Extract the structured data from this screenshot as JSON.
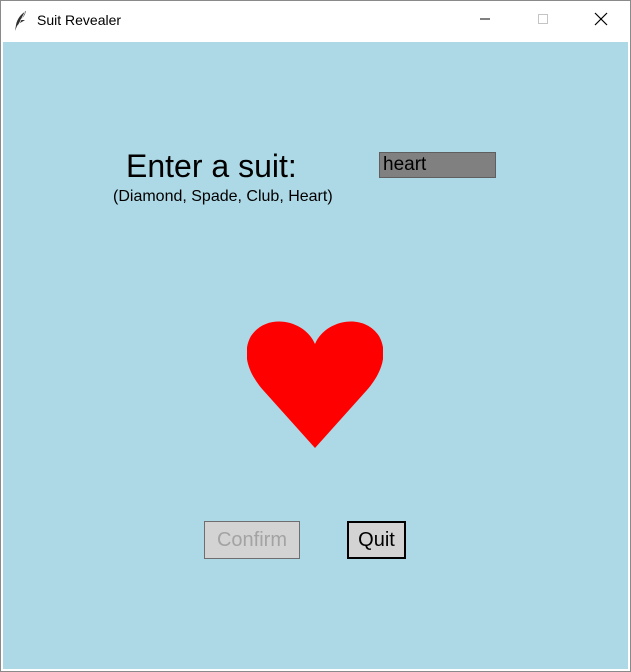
{
  "window": {
    "title": "Suit Revealer",
    "icon": "feather-icon"
  },
  "titlebar_buttons": {
    "minimize": "minimize-icon",
    "maximize": "maximize-icon",
    "close": "close-icon"
  },
  "form": {
    "prompt": "Enter a suit:",
    "hint": "(Diamond, Spade, Club, Heart)",
    "input_value": "heart"
  },
  "display": {
    "suit": "heart",
    "suit_color": "#ff0000"
  },
  "buttons": {
    "confirm_label": "Confirm",
    "confirm_state": "disabled",
    "quit_label": "Quit"
  },
  "colors": {
    "background": "#add8e6",
    "input_background": "#808080",
    "button_background": "#d3d3d3"
  }
}
